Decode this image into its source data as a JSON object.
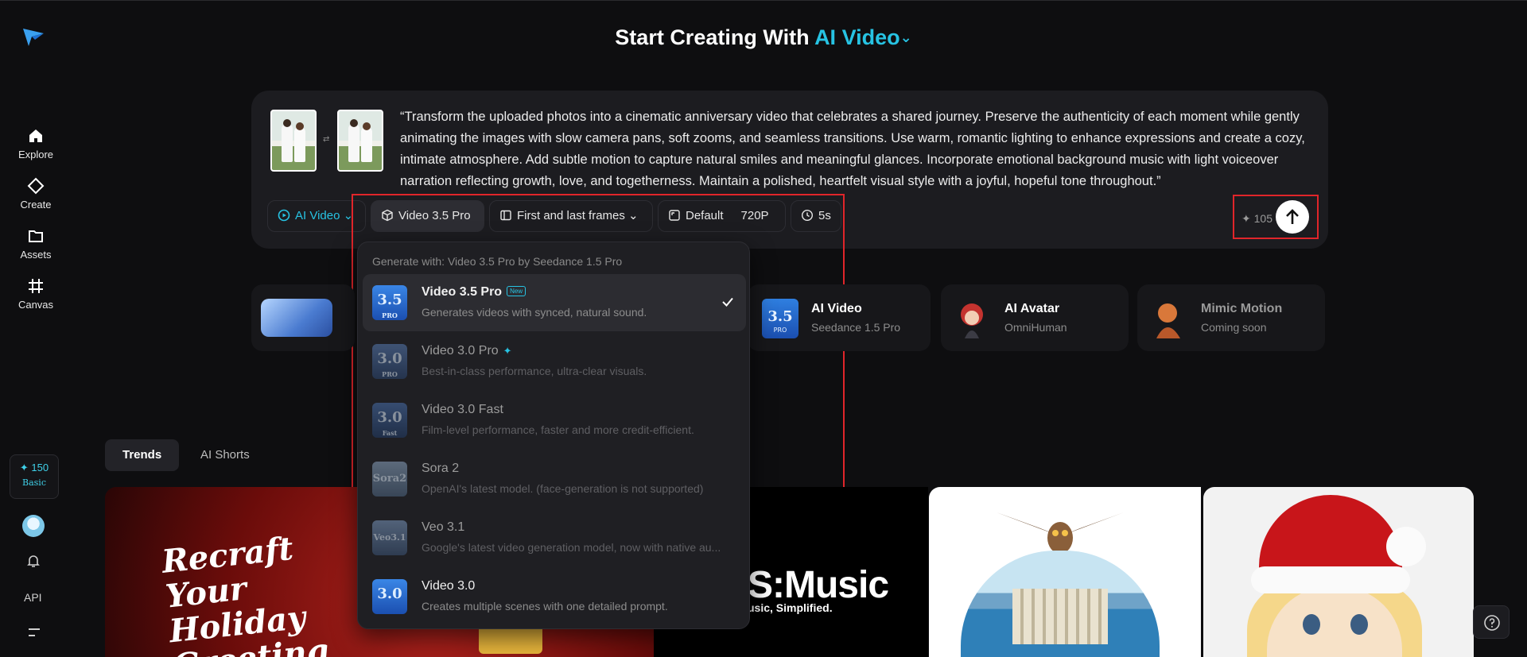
{
  "header": {
    "prefix": "Start Creating With",
    "mode": "AI Video",
    "chevron": "⌄"
  },
  "sidebar": {
    "items": [
      {
        "label": "Explore",
        "icon": "home-icon"
      },
      {
        "label": "Create",
        "icon": "diamond-icon"
      },
      {
        "label": "Assets",
        "icon": "folder-icon"
      },
      {
        "label": "Canvas",
        "icon": "frame-icon"
      }
    ],
    "credits": "✦ 150",
    "plan": "Basic",
    "api_label": "API"
  },
  "prompt": {
    "text": "“Transform the uploaded photos into a cinematic anniversary video that celebrates a shared journey. Preserve the authenticity of each moment while gently animating the images with slow camera pans, soft zooms, and seamless transitions. Use warm, romantic lighting to enhance expressions and create a cozy, intimate atmosphere. Add subtle motion to capture natural smiles and meaningful glances. Incorporate emotional background music with light voiceover narration reflecting growth, love, and togetherness. Maintain a polished, heartfelt visual style with a joyful, hopeful tone throughout.”",
    "swap_symbol": "⇄"
  },
  "toolbar": {
    "mode": "AI Video",
    "model": "Video 3.5 Pro",
    "frames": "First and last frames",
    "ratio": "Default",
    "resolution": "720P",
    "duration": "5s",
    "cost": "✦ 105"
  },
  "features": [
    {
      "title": "AI Video",
      "sub": "Seedance 1.5 Pro"
    },
    {
      "title": "AI Avatar",
      "sub": "OmniHuman"
    },
    {
      "title": "Mimic Motion",
      "sub": "Coming soon"
    }
  ],
  "tabs": [
    "Trends",
    "AI Shorts"
  ],
  "media": {
    "holiday_title": "Recraft Your Holiday Greeting",
    "music_title": "S:Music",
    "music_sub": "usic, Simplified."
  },
  "dropdown": {
    "header": "Generate with: Video 3.5 Pro by Seedance 1.5 Pro",
    "options": [
      {
        "name": "Video 3.5 Pro",
        "badge": "New",
        "desc": "Generates videos with synced, natural sound.",
        "icon_num": "3.5",
        "icon_sub": "PRO",
        "selected": true
      },
      {
        "name": "Video 3.0 Pro",
        "badge": "✦",
        "desc": "Best-in-class performance, ultra-clear visuals.",
        "icon_num": "3.0",
        "icon_sub": "PRO"
      },
      {
        "name": "Video 3.0 Fast",
        "desc": "Film-level performance, faster and more credit-efficient.",
        "icon_num": "3.0",
        "icon_sub": "Fast"
      },
      {
        "name": "Sora 2",
        "desc": "OpenAI's latest model. (face-generation is not supported)",
        "icon_num": "Sora2",
        "icon_sub": ""
      },
      {
        "name": "Veo 3.1",
        "desc": "Google's latest video generation model, now with native au...",
        "icon_num": "Veo3.1",
        "icon_sub": ""
      },
      {
        "name": "Video 3.0",
        "desc": "Creates multiple scenes with one detailed prompt.",
        "icon_num": "3.0",
        "icon_sub": ""
      }
    ]
  },
  "colors": {
    "accent": "#27c3e3",
    "highlight_box": "#e0252a",
    "background": "#0e0e10",
    "card": "#1c1c20"
  }
}
